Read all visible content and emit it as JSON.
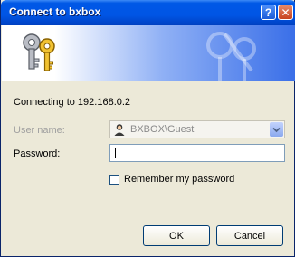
{
  "window": {
    "title": "Connect to bxbox",
    "help_label": "?",
    "close_label": "✕"
  },
  "dialog": {
    "connecting_text": "Connecting to 192.168.0.2",
    "username_label": "User name:",
    "username_value": "BXBOX\\Guest",
    "password_label": "Password:",
    "password_value": "",
    "remember_label": "Remember my password",
    "remember_checked": false
  },
  "buttons": {
    "ok_label": "OK",
    "cancel_label": "Cancel"
  },
  "icons": {
    "banner": "keys-icon",
    "user": "user-icon",
    "dropdown": "chevron-down-icon"
  },
  "colors": {
    "titlebar": "#0055e5",
    "window_bg": "#ece9d8",
    "banner_end": "#3a6fe8"
  }
}
